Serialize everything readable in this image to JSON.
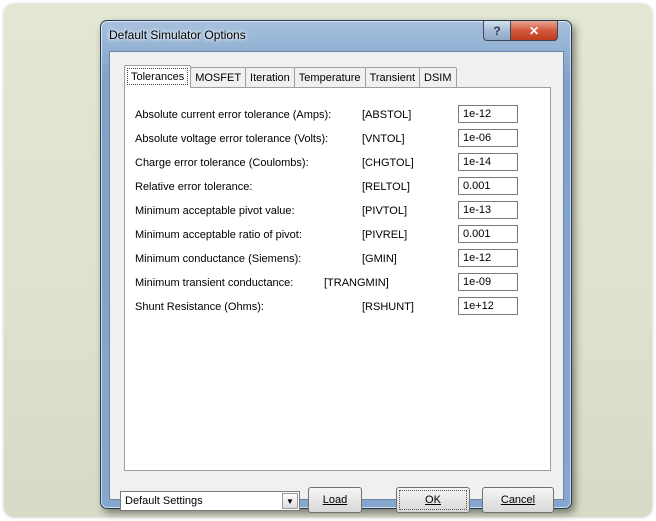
{
  "window": {
    "title": "Default Simulator Options",
    "help_glyph": "?",
    "close_glyph": "✕"
  },
  "tabs": [
    {
      "label": "Tolerances"
    },
    {
      "label": "MOSFET"
    },
    {
      "label": "Iteration"
    },
    {
      "label": "Temperature"
    },
    {
      "label": "Transient"
    },
    {
      "label": "DSIM"
    }
  ],
  "rows": [
    {
      "label": "Absolute current error tolerance (Amps):",
      "param": "[ABSTOL]",
      "value": "1e-12"
    },
    {
      "label": "Absolute voltage error tolerance (Volts):",
      "param": "[VNTOL]",
      "value": "1e-06"
    },
    {
      "label": "Charge error tolerance (Coulombs):",
      "param": "[CHGTOL]",
      "value": "1e-14"
    },
    {
      "label": "Relative error tolerance:",
      "param": "[RELTOL]",
      "value": "0.001"
    },
    {
      "label": "Minimum acceptable pivot value:",
      "param": "[PIVTOL]",
      "value": "1e-13"
    },
    {
      "label": "Minimum acceptable ratio of pivot:",
      "param": "[PIVREL]",
      "value": "0.001"
    },
    {
      "label": "Minimum conductance (Siemens):",
      "param": "[GMIN]",
      "value": "1e-12"
    },
    {
      "label": "Minimum transient conductance:",
      "param": "[TRANGMIN]",
      "value": "1e-09"
    },
    {
      "label": "Shunt Resistance (Ohms):",
      "param": "[RSHUNT]",
      "value": "1e+12"
    }
  ],
  "footer": {
    "settings_selected": "Default Settings",
    "load_label": "Load",
    "ok_label": "OK",
    "cancel_label": "Cancel"
  }
}
